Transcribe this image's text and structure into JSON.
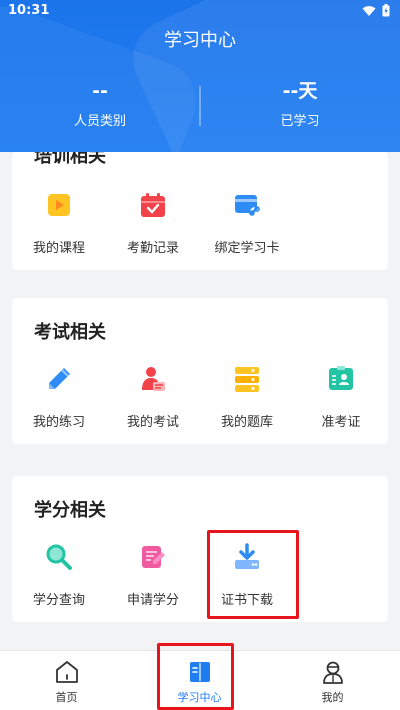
{
  "status_bar": {
    "time": "10:31"
  },
  "header": {
    "title": "学习中心",
    "stats": [
      {
        "value": "--",
        "label": "人员类别"
      },
      {
        "value": "--天",
        "label": "已学习"
      }
    ]
  },
  "sections": [
    {
      "title": "培训相关",
      "items": [
        {
          "label": "我的课程",
          "icon": "play-icon"
        },
        {
          "label": "考勤记录",
          "icon": "calendar-icon"
        },
        {
          "label": "绑定学习卡",
          "icon": "card-link-icon"
        }
      ]
    },
    {
      "title": "考试相关",
      "items": [
        {
          "label": "我的练习",
          "icon": "pencil-icon"
        },
        {
          "label": "我的考试",
          "icon": "exam-icon"
        },
        {
          "label": "我的题库",
          "icon": "question-bank-icon"
        },
        {
          "label": "准考证",
          "icon": "admission-ticket-icon"
        }
      ]
    },
    {
      "title": "学分相关",
      "items": [
        {
          "label": "学分查询",
          "icon": "search-icon"
        },
        {
          "label": "申请学分",
          "icon": "apply-edit-icon"
        },
        {
          "label": "证书下载",
          "icon": "download-icon"
        }
      ]
    }
  ],
  "tabbar": {
    "tabs": [
      {
        "label": "首页",
        "icon": "home-icon",
        "active": false
      },
      {
        "label": "学习中心",
        "icon": "book-icon",
        "active": true
      },
      {
        "label": "我的",
        "icon": "profile-icon",
        "active": false
      }
    ]
  },
  "colors": {
    "primary": "#1f7df2",
    "highlight": "#e8141c"
  }
}
